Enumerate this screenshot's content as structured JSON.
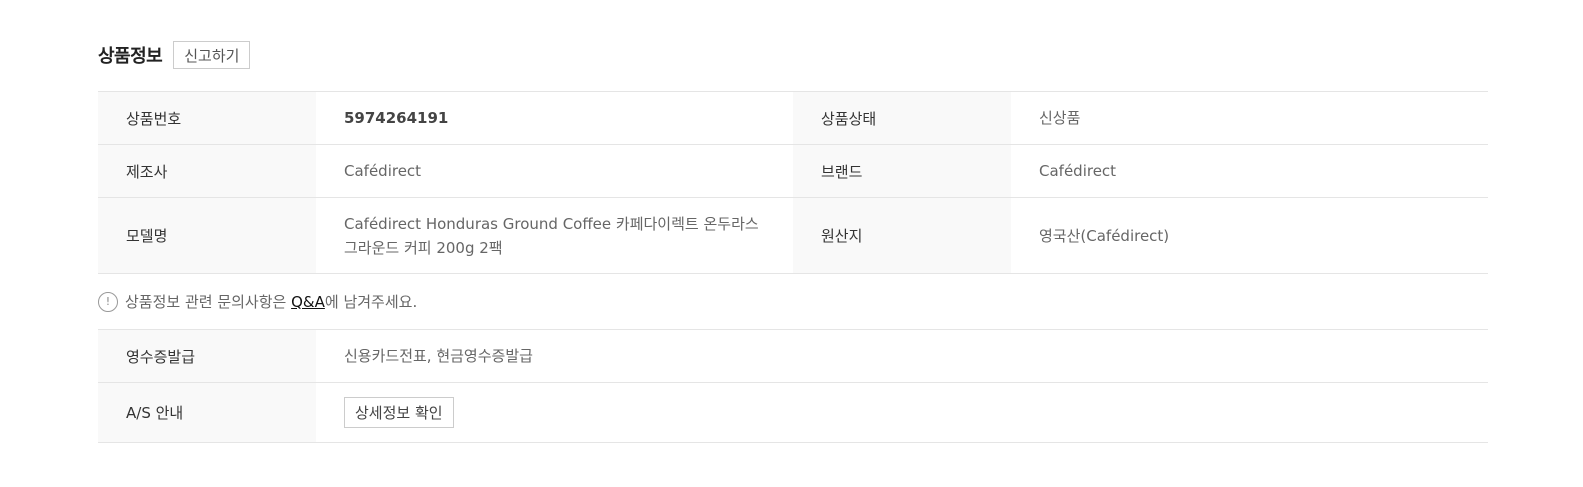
{
  "header": {
    "title": "상품정보",
    "report_label": "신고하기"
  },
  "info_rows": [
    {
      "label1": "상품번호",
      "value1": "5974264191",
      "label2": "상품상태",
      "value2": "신상품"
    },
    {
      "label1": "제조사",
      "value1": "Cafédirect",
      "label2": "브랜드",
      "value2": "Cafédirect"
    },
    {
      "label1": "모델명",
      "value1": "Cafédirect Honduras Ground Coffee 카페다이렉트 온두라스 그라운드 커피 200g 2팩",
      "label2": "원산지",
      "value2": "영국산(Cafédirect)"
    }
  ],
  "notice": {
    "icon": "exclamation-circle-icon",
    "text_before": "상품정보 관련 문의사항은 ",
    "link_label": "Q&A",
    "text_after": "에 남겨주세요."
  },
  "extra_rows": {
    "receipt_label": "영수증발급",
    "receipt_value": "신용카드전표, 현금영수증발급",
    "as_label": "A/S 안내",
    "as_button_label": "상세정보 확인"
  }
}
